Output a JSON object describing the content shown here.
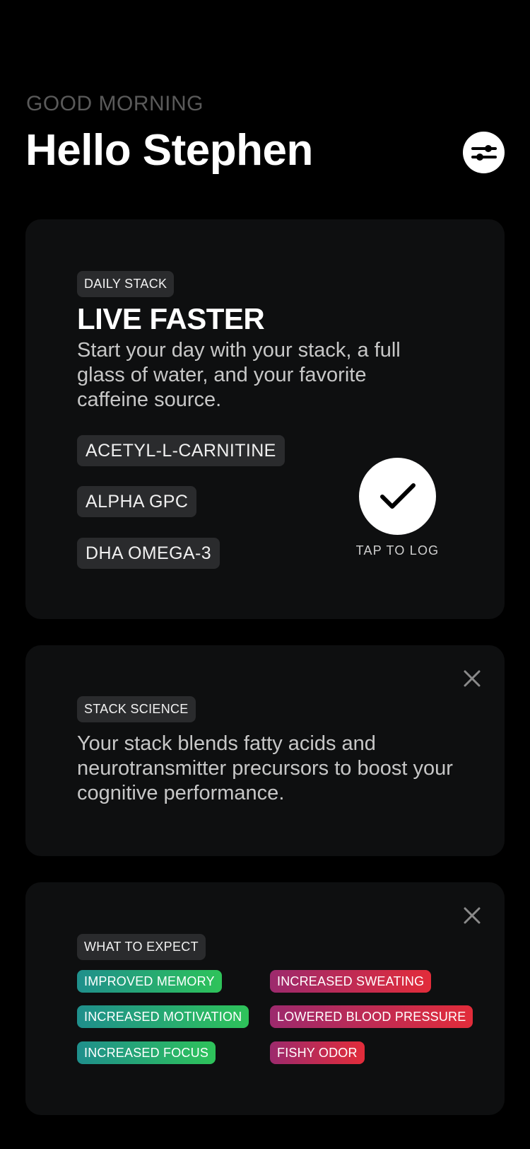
{
  "header": {
    "subtitle": "GOOD MORNING",
    "title": "Hello Stephen",
    "settings_icon": "sliders-icon"
  },
  "stack_card": {
    "tag": "DAILY STACK",
    "title": "LIVE FASTER",
    "description": "Start your day with your stack, a full glass of water, and your favorite caffeine source.",
    "supplements": [
      "ACETYL-L-CARNITINE",
      "ALPHA GPC",
      "DHA OMEGA-3"
    ],
    "log_label": "TAP TO LOG",
    "log_icon": "checkmark-icon"
  },
  "science_card": {
    "tag": "STACK SCIENCE",
    "text": "Your stack blends fatty acids and neurotransmitter precursors to boost your cognitive performance.",
    "close_icon": "close-icon"
  },
  "expect_card": {
    "tag": "WHAT TO EXPECT",
    "positive_effects": [
      "IMPROVED MEMORY",
      "INCREASED MOTIVATION",
      "INCREASED FOCUS"
    ],
    "negative_effects": [
      "INCREASED SWEATING",
      "LOWERED BLOOD PRESSURE",
      "FISHY ODOR"
    ],
    "close_icon": "close-icon"
  },
  "colors": {
    "background": "#000000",
    "card": "#0e0f10",
    "tag": "#2a2b2d",
    "positive_gradient": [
      "#1f8f8c",
      "#2ec35a"
    ],
    "negative_gradient": [
      "#9c2a6d",
      "#e22c3a"
    ]
  }
}
